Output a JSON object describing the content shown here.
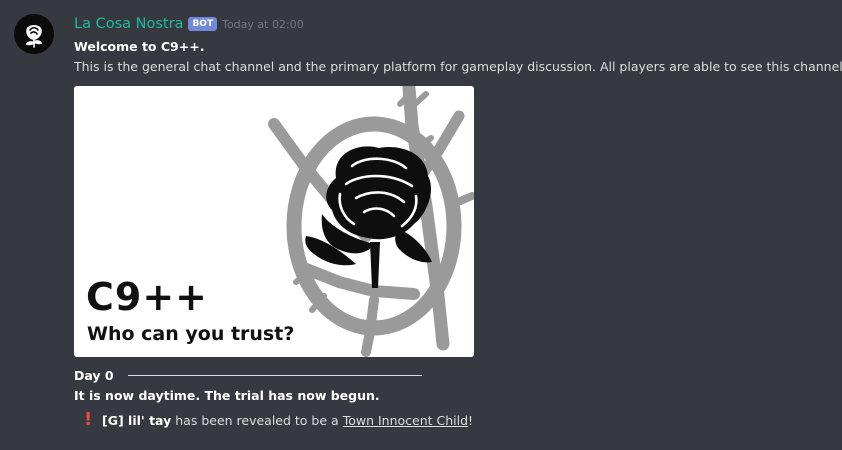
{
  "message": {
    "username": "La Cosa Nostra",
    "bot_tag": "BOT",
    "timestamp": "Today at 02:00",
    "welcome_title": "Welcome to C9++.",
    "description": "This is the general chat channel and the primary platform for gameplay discussion. All players are able to see this channel.",
    "image": {
      "title": "C9++",
      "subtitle": "Who can you trust?"
    },
    "day_label": "Day 0",
    "daytime_notice": "It is now daytime. The trial has now begun.",
    "reveal": {
      "icon": "exclamation-icon",
      "player": "[G] lil' tay",
      "text": "has been revealed to be a",
      "role": "Town Innocent Child",
      "punctuation": "!"
    }
  },
  "colors": {
    "background": "#36393f",
    "username": "#1abc9c",
    "bot_tag": "#7289da",
    "timestamp": "#72767d",
    "exclamation": "#f04747"
  }
}
